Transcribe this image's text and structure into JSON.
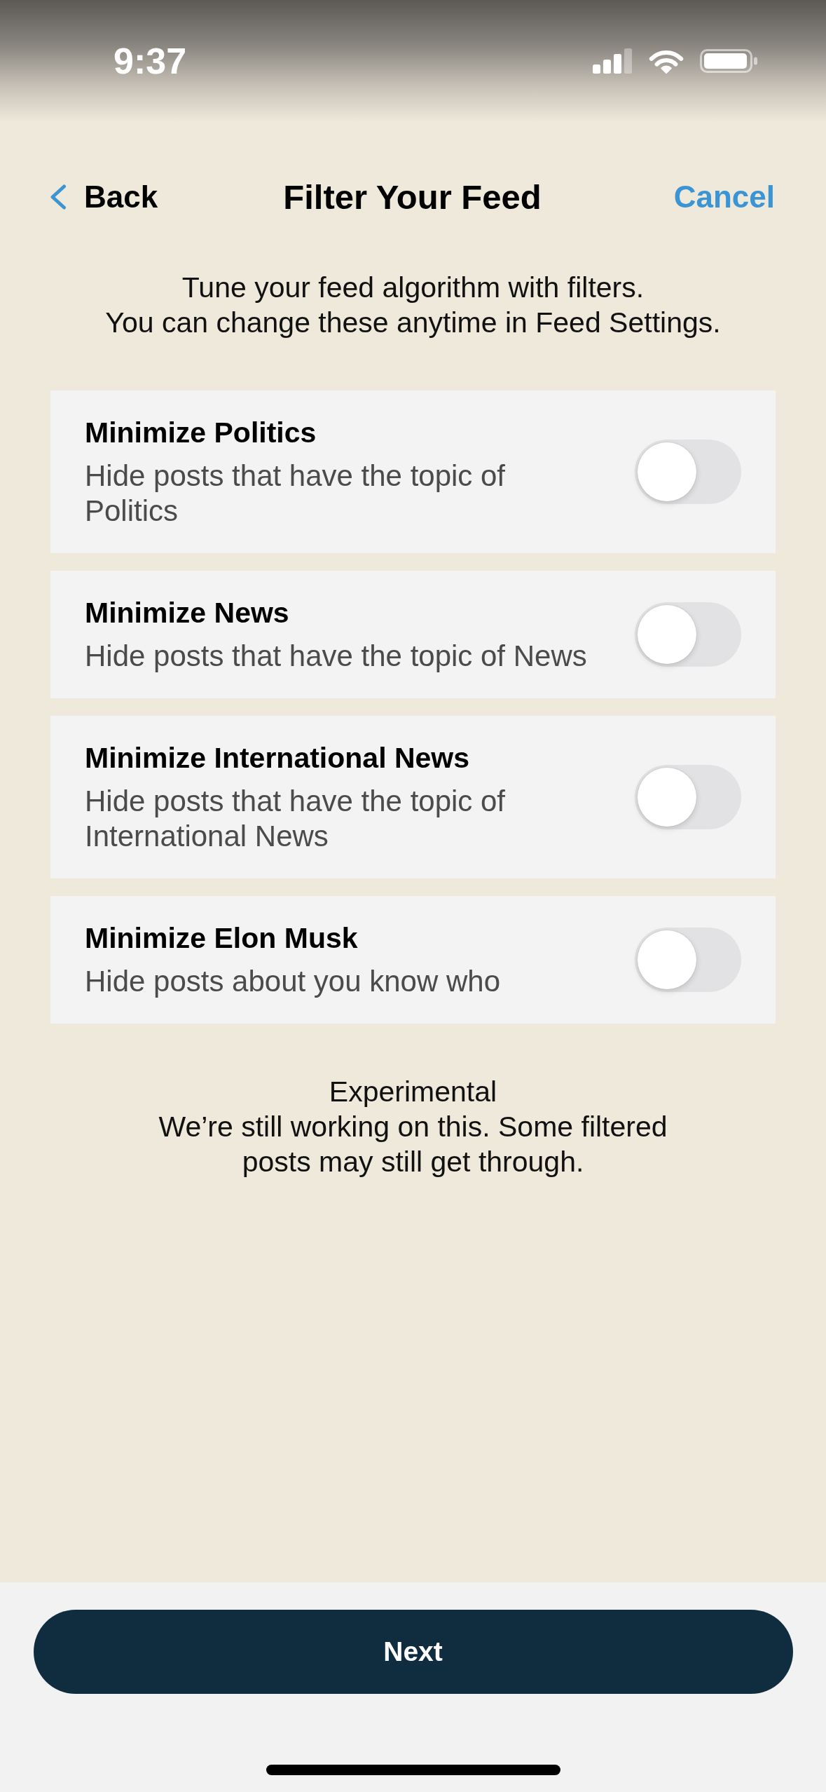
{
  "status_bar": {
    "time": "9:37"
  },
  "nav": {
    "back": "Back",
    "title": "Filter Your Feed",
    "cancel": "Cancel"
  },
  "intro": "Tune your feed algorithm with filters.\nYou can change these anytime in Feed Settings.",
  "filters": [
    {
      "title": "Minimize Politics",
      "description": "Hide posts that have the topic of Politics",
      "on": false
    },
    {
      "title": "Minimize News",
      "description": "Hide posts that have the topic of News",
      "on": false
    },
    {
      "title": "Minimize International News",
      "description": "Hide posts that have the topic of International News",
      "on": false
    },
    {
      "title": "Minimize Elon Musk",
      "description": "Hide posts about you know who",
      "on": false
    }
  ],
  "note": {
    "title": "Experimental",
    "text": "We’re still working on this. Some filtered posts may still get through."
  },
  "next_button": "Next"
}
